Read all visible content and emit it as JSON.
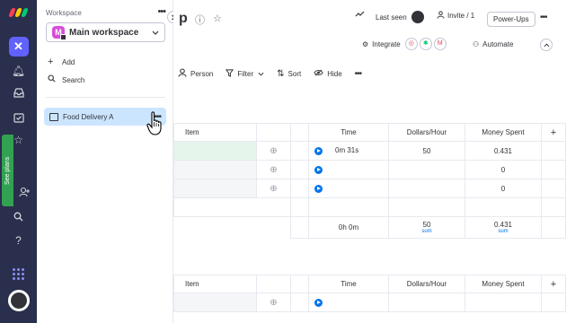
{
  "rail": {
    "see_plans": "See plans",
    "help": "?"
  },
  "workspace_panel": {
    "header": "Workspace",
    "more": "•••",
    "workspace_badge": "M",
    "workspace_name": "Main workspace",
    "add_label": "Add",
    "search_label": "Search",
    "board_label": "Food Delivery A",
    "board_more": "•••"
  },
  "board": {
    "title_fragment": "p",
    "last_seen": "Last seen",
    "invite": "Invite / 1",
    "powerups": "Power-Ups",
    "more": "•••",
    "integrate": "Integrate",
    "automate": "Automate",
    "toolbar": {
      "person": "Person",
      "filter": "Filter",
      "sort": "Sort",
      "hide": "Hide",
      "more": "•••"
    }
  },
  "table": {
    "headers": {
      "item": "Item",
      "time": "Time",
      "dollars": "Dollars/Hour",
      "money": "Money Spent",
      "add": "+"
    },
    "rows": [
      {
        "time": "0m 31s",
        "dollars": "50",
        "money": "0.431"
      },
      {
        "time": "",
        "dollars": "",
        "money": "0"
      },
      {
        "time": "",
        "dollars": "",
        "money": "0"
      }
    ],
    "summary": {
      "time": "0h 0m",
      "dollars": "50",
      "dollars_label": "sum",
      "money": "0.431",
      "money_label": "sum"
    }
  },
  "table2": {
    "headers": {
      "item": "Item",
      "time": "Time",
      "dollars": "Dollars/Hour",
      "money": "Money Spent",
      "add": "+"
    }
  },
  "colors": {
    "rail_bg": "#292f4c",
    "primary": "#0073ea",
    "see_plans_bg": "#33a152",
    "selected_board_bg": "#cce5ff",
    "workspace_badge_bg": "#d94dd9"
  }
}
